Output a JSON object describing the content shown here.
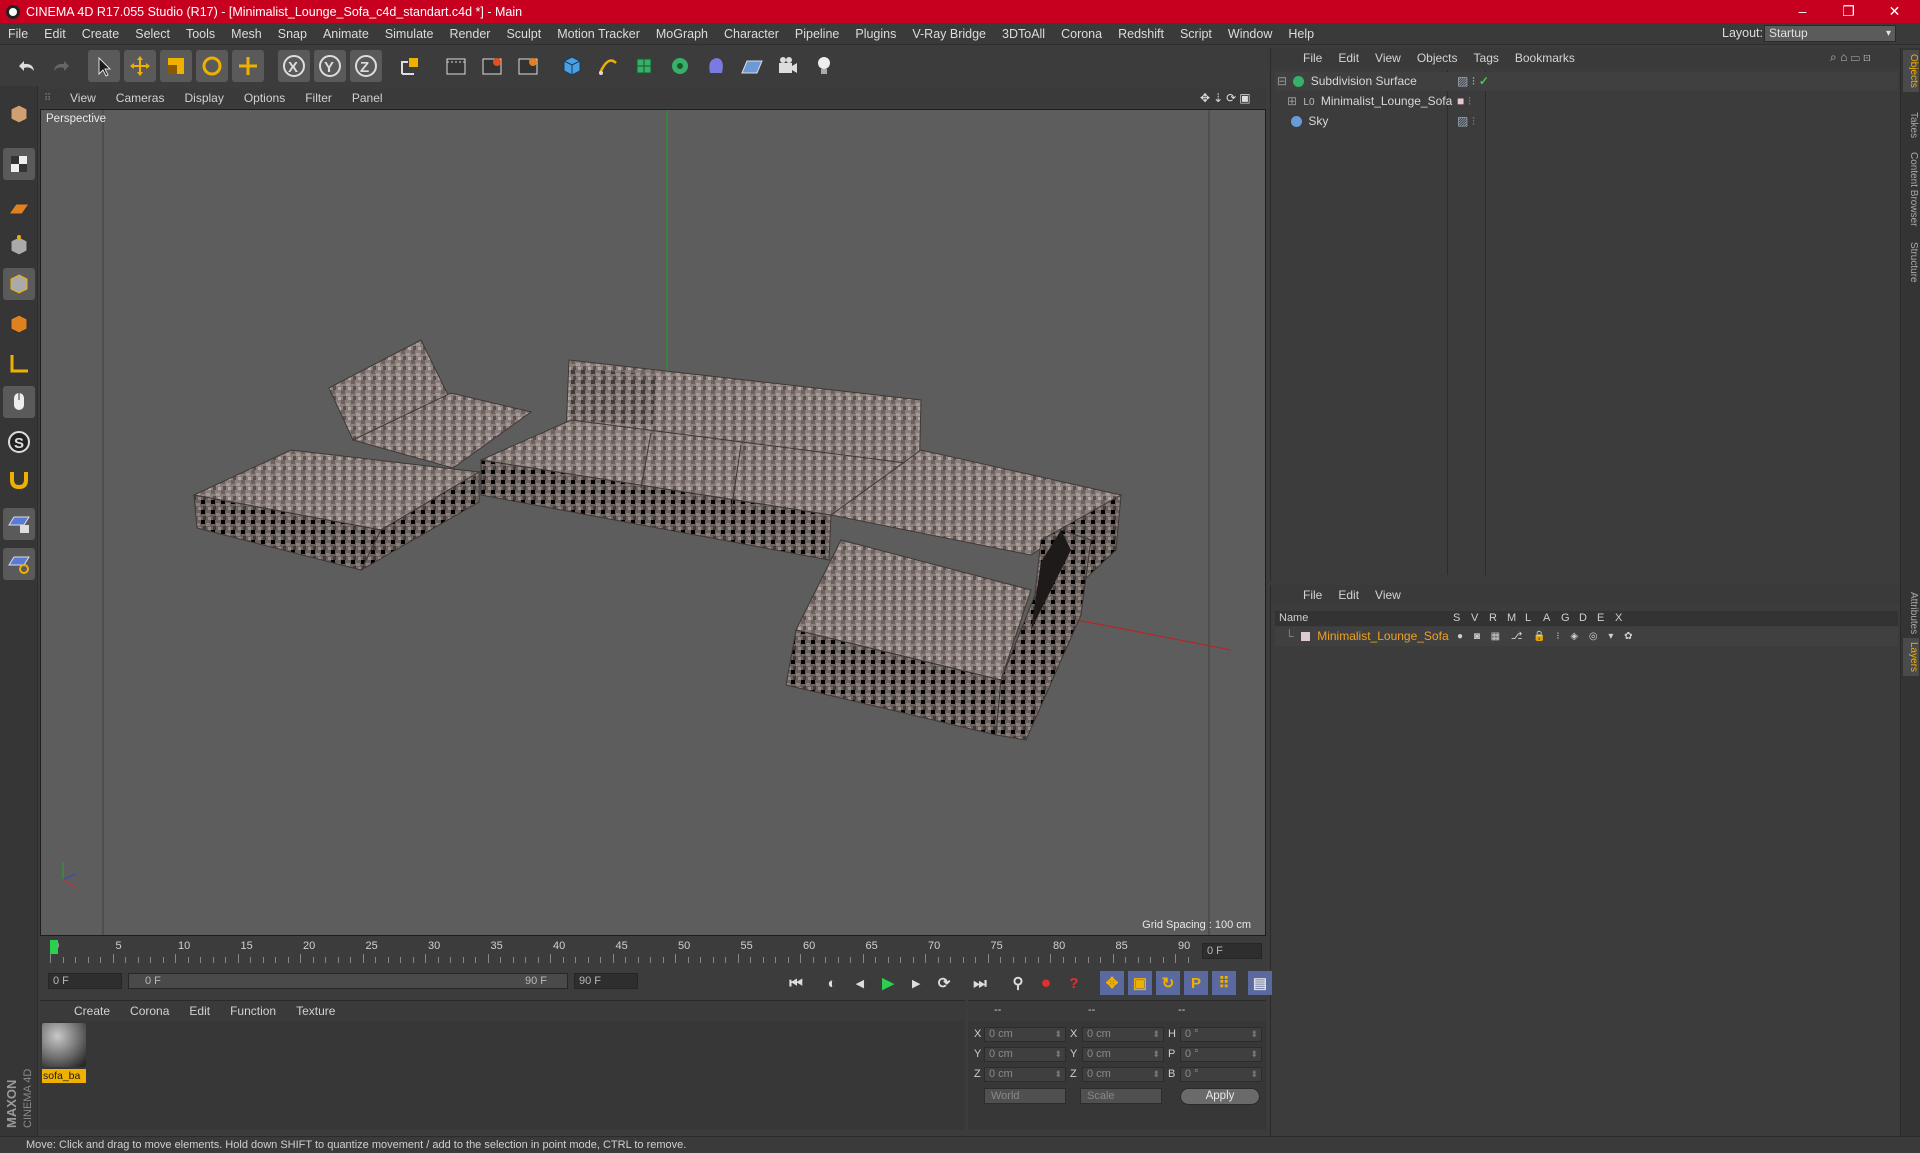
{
  "title": "CINEMA 4D R17.055 Studio (R17) - [Minimalist_Lounge_Sofa_c4d_standart.c4d *] - Main",
  "window_controls": [
    "–",
    "❐",
    "✕"
  ],
  "menu": [
    "File",
    "Edit",
    "Create",
    "Select",
    "Tools",
    "Mesh",
    "Snap",
    "Animate",
    "Simulate",
    "Render",
    "Sculpt",
    "Motion Tracker",
    "MoGraph",
    "Character",
    "Pipeline",
    "Plugins",
    "V-Ray Bridge",
    "3DToAll",
    "Corona",
    "Redshift",
    "Script",
    "Window",
    "Help"
  ],
  "layout": {
    "label": "Layout:",
    "value": "Startup"
  },
  "toolbar_icons": [
    "undo-icon",
    "redo-icon",
    "select-arrow-icon",
    "move-icon",
    "scale-icon",
    "rotate-icon",
    "move-plus-icon",
    "x-axis-icon",
    "y-axis-icon",
    "z-axis-icon",
    "world-coord-icon",
    "render-region-icon",
    "render-view-icon",
    "render-settings-icon",
    "cube-icon",
    "pen-icon",
    "subdivision-icon",
    "array-icon",
    "deformer-icon",
    "floor-icon",
    "camera-icon",
    "light-icon"
  ],
  "left_tool_icons": [
    "model-mode-icon",
    "texture-mode-icon",
    "workplane-icon",
    "points-icon",
    "edges-icon",
    "polygons-icon",
    "axis-icon",
    "tweak-icon",
    "snap-s-icon",
    "magnet-icon",
    "lock-grid-icon",
    "rotate-grid-icon"
  ],
  "viewport": {
    "menu": [
      "View",
      "Cameras",
      "Display",
      "Options",
      "Filter",
      "Panel"
    ],
    "label": "Perspective",
    "grid_spacing": "Grid Spacing : 100 cm"
  },
  "timeline": {
    "ticks": [
      "0",
      "5",
      "10",
      "15",
      "20",
      "25",
      "30",
      "35",
      "40",
      "45",
      "50",
      "55",
      "60",
      "65",
      "70",
      "75",
      "80",
      "85",
      "90"
    ],
    "current_frame": "0 F",
    "start_field": "0 F",
    "range_start": "0 F",
    "range_end": "90 F",
    "end_field": "90 F"
  },
  "material_panel": {
    "menu": [
      "Create",
      "Corona",
      "Edit",
      "Function",
      "Texture"
    ],
    "materials": [
      {
        "name": "sofa_ba"
      }
    ]
  },
  "coord_panel": {
    "headers": [
      "--",
      "--",
      "--"
    ],
    "rows": [
      {
        "axis1": "X",
        "v1": "0 cm",
        "axis2": "X",
        "v2": "0 cm",
        "axis3": "H",
        "v3": "0 °"
      },
      {
        "axis1": "Y",
        "v1": "0 cm",
        "axis2": "Y",
        "v2": "0 cm",
        "axis3": "P",
        "v3": "0 °"
      },
      {
        "axis1": "Z",
        "v1": "0 cm",
        "axis2": "Z",
        "v2": "0 cm",
        "axis3": "B",
        "v3": "0 °"
      }
    ],
    "world": "World",
    "scale": "Scale",
    "apply": "Apply"
  },
  "object_panel": {
    "menu": [
      "File",
      "Edit",
      "View",
      "Objects",
      "Tags",
      "Bookmarks"
    ],
    "objects": [
      {
        "name": "Subdivision Surface"
      },
      {
        "name": "Minimalist_Lounge_Sofa"
      },
      {
        "name": "Sky"
      }
    ]
  },
  "layer_panel": {
    "menu": [
      "File",
      "Edit",
      "View"
    ],
    "columns": [
      "Name",
      "S",
      "V",
      "R",
      "M",
      "L",
      "A",
      "G",
      "D",
      "E",
      "X"
    ],
    "layers": [
      {
        "name": "Minimalist_Lounge_Sofa",
        "color": "#f0a020"
      }
    ]
  },
  "side_tabs": [
    "Objects",
    "Takes",
    "Content Browser",
    "Structure",
    "Attributes",
    "Layers"
  ],
  "status": "Move: Click and drag to move elements. Hold down SHIFT to quantize movement / add to the selection in point mode, CTRL to remove.",
  "brand": "MAXON CINEMA 4D",
  "colors": {
    "titlebar": "#c8001f",
    "accent": "#f0b000",
    "viewport": "#5d5d5d"
  }
}
